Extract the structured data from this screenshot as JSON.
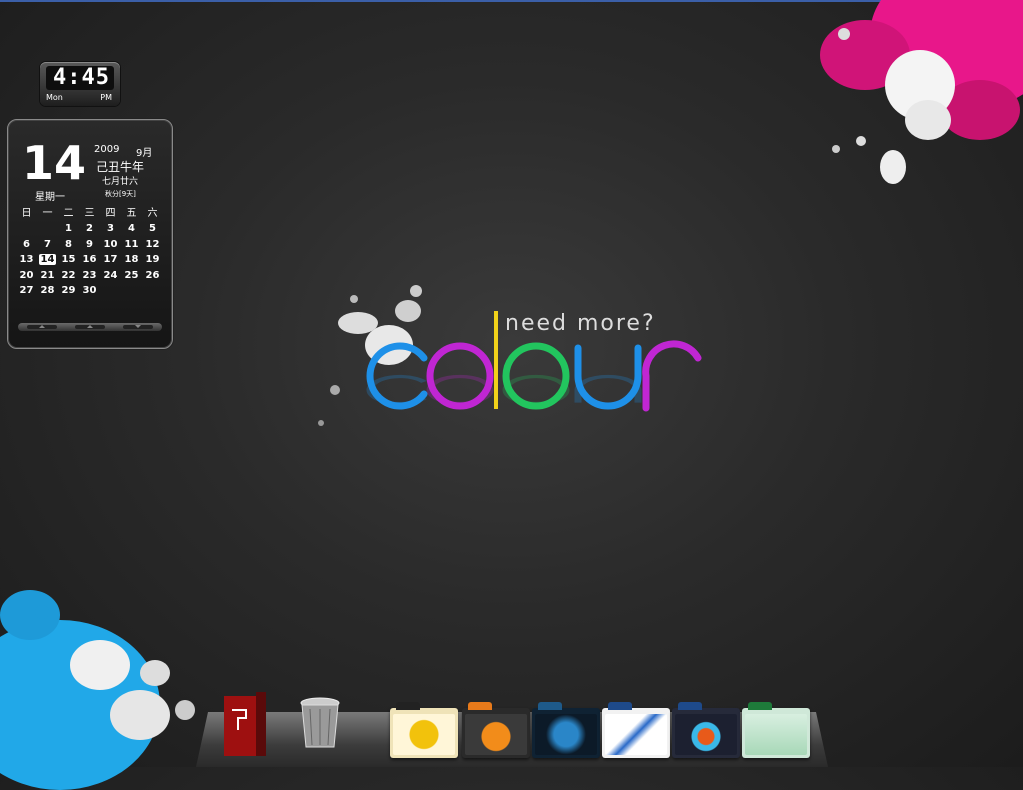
{
  "clock": {
    "time": "4:45",
    "day": "Mon",
    "ampm": "PM"
  },
  "calendar": {
    "day_number": "14",
    "year": "2009",
    "month": "9月",
    "ganzhi_year": "己丑牛年",
    "lunar_date": "七月廿六",
    "weekday": "星期一",
    "solar_term": "秋分[9天]",
    "week_headers": [
      "日",
      "一",
      "二",
      "三",
      "四",
      "五",
      "六"
    ],
    "weeks": [
      [
        "",
        "",
        "1",
        "2",
        "3",
        "4",
        "5"
      ],
      [
        "6",
        "7",
        "8",
        "9",
        "10",
        "11",
        "12"
      ],
      [
        "13",
        "14",
        "15",
        "16",
        "17",
        "18",
        "19"
      ],
      [
        "20",
        "21",
        "22",
        "23",
        "24",
        "25",
        "26"
      ],
      [
        "27",
        "28",
        "29",
        "30",
        "",
        "",
        ""
      ]
    ],
    "today": "14"
  },
  "logo": {
    "tagline": "need more?",
    "word": "colour"
  },
  "colors": {
    "blue": "#1e90e8",
    "purple": "#c026d3",
    "yellow": "#f2d21a",
    "green": "#22c55e",
    "pink": "#e8178a",
    "cyan": "#21a8e8"
  },
  "dock": {
    "items": [
      {
        "name": "pdf-reader-icon"
      },
      {
        "name": "trash-icon"
      },
      {
        "name": "folder-robot-icon"
      },
      {
        "name": "folder-radiation-icon"
      },
      {
        "name": "folder-blue-creature-icon"
      },
      {
        "name": "folder-sketch-icon"
      },
      {
        "name": "folder-figure-icon"
      },
      {
        "name": "folder-tree-icon"
      }
    ]
  }
}
